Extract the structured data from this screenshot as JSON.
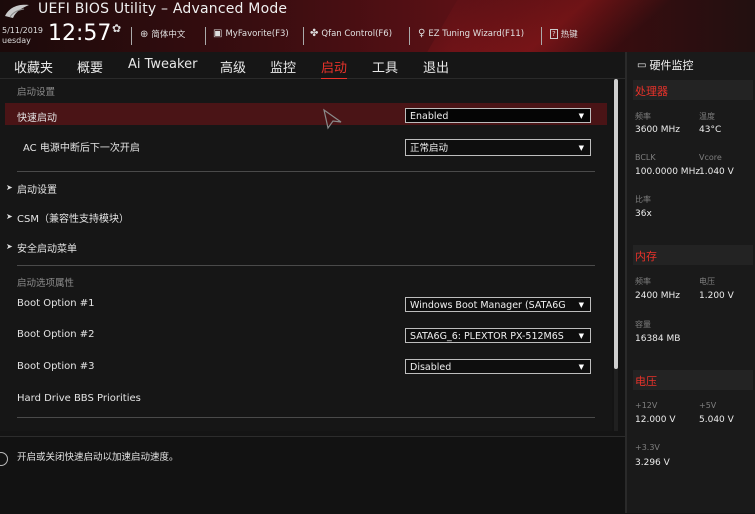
{
  "header": {
    "title": "UEFI BIOS Utility – Advanced Mode",
    "date": "5/11/2019",
    "day": "uesday",
    "time": "12:57",
    "tools": [
      {
        "icon": "globe-icon",
        "label": "简体中文"
      },
      {
        "icon": "favorite-icon",
        "label": "MyFavorite(F3)"
      },
      {
        "icon": "fan-icon",
        "label": "Qfan Control(F6)"
      },
      {
        "icon": "bulb-icon",
        "label": "EZ Tuning Wizard(F11)"
      },
      {
        "icon": "help-key-icon",
        "label": "热键"
      }
    ]
  },
  "nav": {
    "tabs": [
      "收藏夹",
      "概要",
      "Ai Tweaker",
      "高级",
      "监控",
      "启动",
      "工具",
      "退出"
    ],
    "active": "启动"
  },
  "main": {
    "section_boot_config": "启动设置",
    "fast_boot_label": "快速启动",
    "fast_boot_value": "Enabled",
    "ac_power_label": "AC 电源中断后下一次开启",
    "ac_power_value": "正常启动",
    "submenu_boot": "启动设置",
    "submenu_csm": "CSM（兼容性支持模块）",
    "submenu_secure": "安全启动菜单",
    "section_priority": "启动选项属性",
    "boot_options": [
      {
        "label": "Boot Option #1",
        "value": "Windows Boot Manager (SATA6G"
      },
      {
        "label": "Boot Option #2",
        "value": "SATA6G_6: PLEXTOR PX-512M6S"
      },
      {
        "label": "Boot Option #3",
        "value": "Disabled"
      }
    ],
    "hdd_bbs": "Hard Drive BBS Priorities",
    "help_text": "开启或关闭快速启动以加速启动速度。"
  },
  "panel": {
    "title": "硬件监控",
    "cpu": {
      "heading": "处理器",
      "freq_label": "频率",
      "freq": "3600 MHz",
      "temp_label": "温度",
      "temp": "43°C",
      "bclk_label": "BCLK",
      "bclk": "100.0000 MHz",
      "vcore_label": "Vcore",
      "vcore": "1.040 V",
      "ratio_label": "比率",
      "ratio": "36x"
    },
    "memory": {
      "heading": "内存",
      "freq_label": "频率",
      "freq": "2400 MHz",
      "volt_label": "电压",
      "volt": "1.200 V",
      "cap_label": "容量",
      "cap": "16384 MB"
    },
    "voltage": {
      "heading": "电压",
      "v12_label": "+12V",
      "v12": "12.000 V",
      "v5_label": "+5V",
      "v5": "5.040 V",
      "v33_label": "+3.3V",
      "v33": "3.296 V"
    }
  },
  "colors": {
    "accent": "#e8322a",
    "highlight_row": "#4a1416",
    "background": "#161616"
  }
}
